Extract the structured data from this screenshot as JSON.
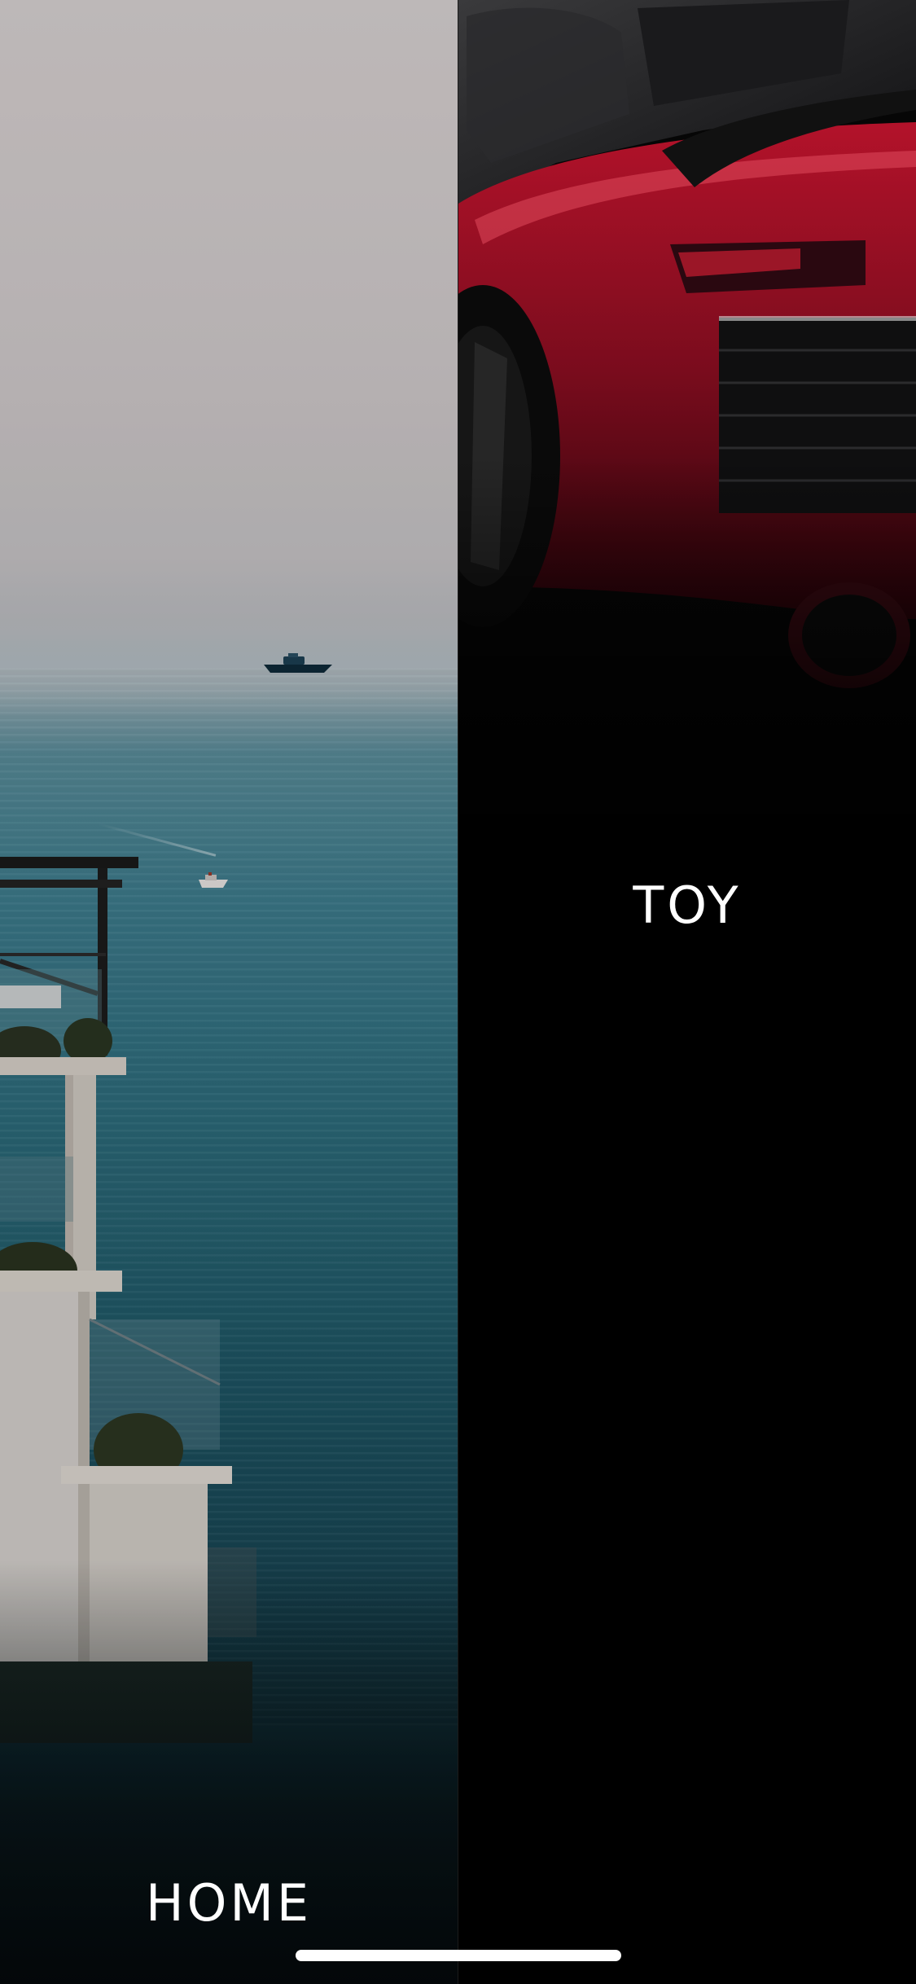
{
  "panels": [
    {
      "label": "HOME",
      "image": "coastal-sea-building-photo"
    },
    {
      "label": "TOY",
      "image": "red-sports-car-photo"
    }
  ],
  "colors": {
    "label_text": "#ffffff",
    "background": "#000000",
    "home_indicator": "#ffffff"
  }
}
